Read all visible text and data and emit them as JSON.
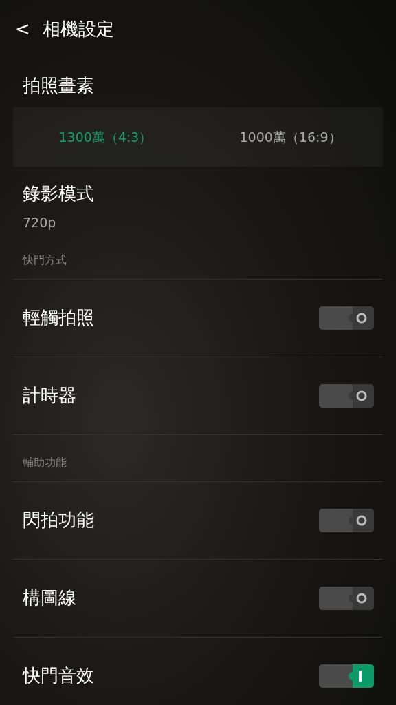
{
  "header": {
    "back": "<",
    "title": "相機設定"
  },
  "photo_resolution": {
    "label": "拍照畫素",
    "options": [
      {
        "label": "1300萬（4:3）",
        "selected": true
      },
      {
        "label": "1000萬（16:9）",
        "selected": false
      }
    ]
  },
  "video_mode": {
    "label": "錄影模式",
    "value": "720p"
  },
  "sections": [
    {
      "title": "快門方式",
      "items": [
        {
          "label": "輕觸拍照",
          "on": false
        },
        {
          "label": "計時器",
          "on": false
        }
      ]
    },
    {
      "title": "輔助功能",
      "items": [
        {
          "label": "閃拍功能",
          "on": false
        },
        {
          "label": "構圖線",
          "on": false
        },
        {
          "label": "快門音效",
          "on": true
        }
      ]
    }
  ]
}
